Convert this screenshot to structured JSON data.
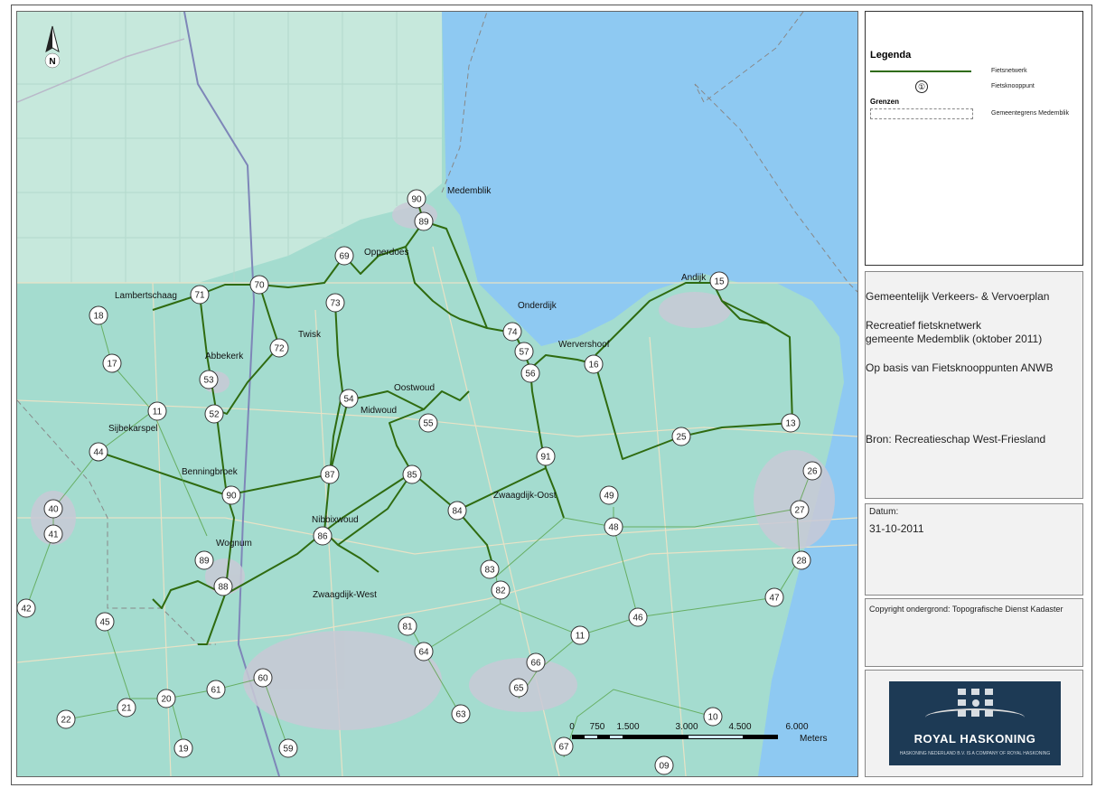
{
  "legend": {
    "title": "Legenda",
    "network_label": "Fietsnetwerk",
    "node_label": "Fietsknooppunt",
    "node_symbol": "①",
    "borders_title": "Grenzen",
    "border_label": "Gemeentegrens Medemblik"
  },
  "title_block": {
    "line1": "Gemeentelijk Verkeers- & Vervoerplan",
    "line2": "Recreatief fietsknetwerk",
    "line3": "gemeente Medemblik (oktober 2011)",
    "line4": "Op basis van Fietsknooppunten ANWB",
    "source": "Bron: Recreatieschap West-Friesland"
  },
  "date": {
    "label": "Datum:",
    "value": "31-10-2011"
  },
  "copyright": "Copyright ondergrond: Topografische Dienst Kadaster",
  "logo": {
    "name": "ROYAL HASKONING",
    "sub": "HASKONING NEDERLAND B.V. IS A COMPANY OF ROYAL HASKONING"
  },
  "north_label": "N",
  "scale": {
    "ticks": [
      "0",
      "750",
      "1.500",
      "3.000",
      "4.500",
      "6.000"
    ],
    "unit": "Meters"
  },
  "towns": [
    "Medemblik",
    "Opperdoes",
    "Lambertschaag",
    "Twisk",
    "Onderdijk",
    "Andijk",
    "Wervershoof",
    "Abbekerk",
    "Oostwoud",
    "Midwoud",
    "Sijbekarspel",
    "Benningbroek",
    "Zwaagdijk-Oost",
    "Nibbixwoud",
    "Wognum",
    "Zwaagdijk-West"
  ],
  "nodes": [
    "90",
    "89",
    "69",
    "70",
    "71",
    "73",
    "72",
    "53",
    "52",
    "54",
    "55",
    "74",
    "57",
    "56",
    "16",
    "15",
    "13",
    "25",
    "26",
    "91",
    "85",
    "84",
    "87",
    "90",
    "86",
    "89",
    "88",
    "18",
    "17",
    "11",
    "44",
    "40",
    "41",
    "42",
    "45",
    "49",
    "48",
    "27",
    "28",
    "47",
    "46",
    "83",
    "82",
    "81",
    "64",
    "11",
    "66",
    "65",
    "63",
    "60",
    "61",
    "20",
    "21",
    "22",
    "19",
    "59",
    "67",
    "10",
    "09"
  ],
  "colors": {
    "water": "#8ec9f2",
    "land": "#9fd9cf",
    "route": "#2f6b10",
    "logo_bg": "#1d3a55"
  }
}
